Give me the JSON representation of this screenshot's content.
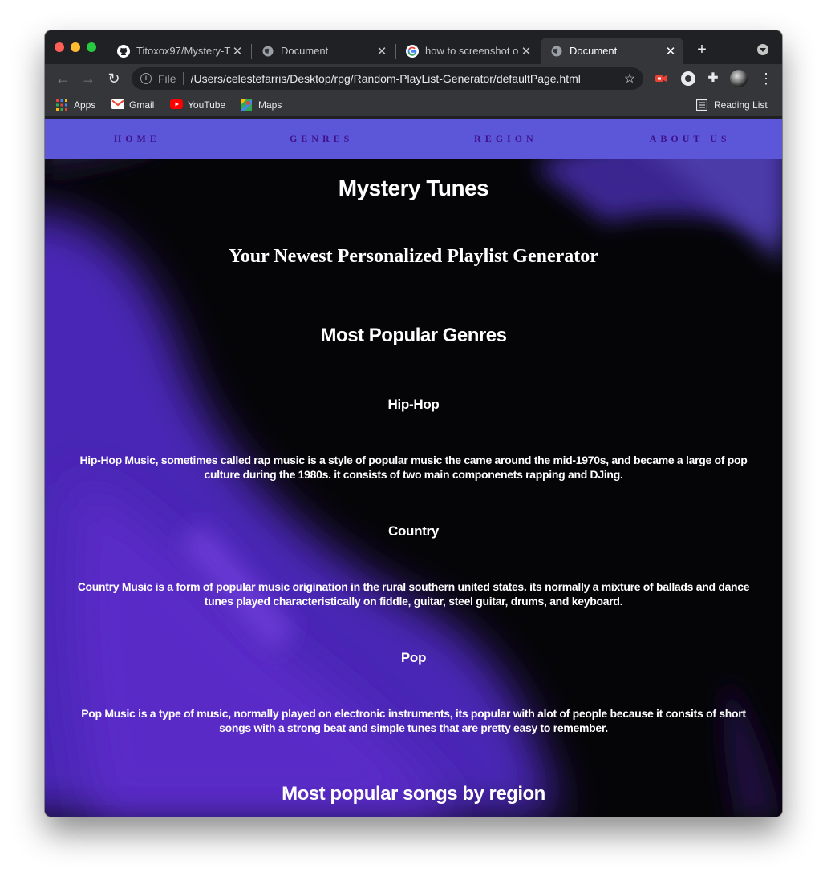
{
  "browser": {
    "tabs": [
      {
        "title": "Titoxox97/Mystery-T",
        "icon": "github-icon",
        "active": false
      },
      {
        "title": "Document",
        "icon": "globe-icon",
        "active": false
      },
      {
        "title": "how to screenshot o",
        "icon": "google-icon",
        "active": false
      },
      {
        "title": "Document",
        "icon": "globe-icon",
        "active": true
      }
    ],
    "address": {
      "scheme": "File",
      "url": "/Users/celestefarris/Desktop/rpg/Random-PlayList-Generator/defaultPage.html"
    },
    "bookmarks": [
      {
        "label": "Apps",
        "icon": "apps-grid-icon"
      },
      {
        "label": "Gmail",
        "icon": "gmail-icon"
      },
      {
        "label": "YouTube",
        "icon": "youtube-icon"
      },
      {
        "label": "Maps",
        "icon": "maps-icon"
      }
    ],
    "reading_list": "Reading List"
  },
  "page": {
    "nav": [
      "HOME",
      "GENRES",
      "REGION",
      "ABOUT US"
    ],
    "title": "Mystery Tunes",
    "tagline": "Your Newest Personalized Playlist Generator",
    "genres_heading": "Most Popular Genres",
    "genres": [
      {
        "name": "Hip-Hop",
        "description": "Hip-Hop Music, sometimes called rap music is a style of popular music the came around the mid-1970s, and became a large of pop culture during the 1980s. it consists of two main componenets rapping and DJing."
      },
      {
        "name": "Country",
        "description": "Country Music is a form of popular music origination in the rural southern united states. its normally a mixture of ballads and dance tunes played characteristically on fiddle, guitar, steel guitar, drums, and keyboard."
      },
      {
        "name": "Pop",
        "description": "Pop Music is a type of music, normally played on electronic instruments, its popular with alot of people because it consits of short songs with a strong beat and simple tunes that are pretty easy to remember."
      }
    ],
    "region_heading": "Most popular songs by region"
  },
  "colors": {
    "nav_bg": "#5b57d8",
    "nav_link": "#3f108a",
    "page_bg": "#050507",
    "purple_glow": "#5a2bc7",
    "text": "#ffffff"
  }
}
